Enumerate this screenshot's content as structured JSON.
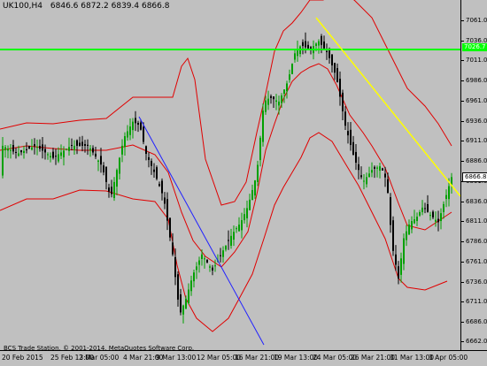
{
  "header": {
    "symbol": "UK100,H4",
    "ohlc": "6846.6 6872.2 6839.4 6866.8"
  },
  "price_axis": {
    "ticks": [
      "7061.0",
      "7036.0",
      "7011.0",
      "6986.0",
      "6961.0",
      "6936.0",
      "6911.0",
      "6886.0",
      "6861.0",
      "6836.0",
      "6811.0",
      "6786.0",
      "6761.0",
      "6736.0",
      "6711.0",
      "6686.0",
      "6662.0"
    ],
    "current_price": "6866.8",
    "hline_price": "7026.7",
    "current_price_bg": "#ffffff",
    "hline_color": "#00ff00"
  },
  "time_axis": {
    "labels": [
      "20 Feb 2015",
      "25 Feb 13:00",
      "2 Mar 05:00",
      "4 Mar 21:00",
      "9 Mar 13:00",
      "12 Mar 05:00",
      "16 Mar 21:00",
      "19 Mar 13:00",
      "24 Mar 05:00",
      "26 Mar 21:00",
      "31 Mar 13:00",
      "3 Apr 05:00"
    ]
  },
  "copyright": "BCS Trade Station, © 2001-2014, MetaQuotes Software Corp.",
  "colors": {
    "background": "#c0c0c0",
    "bull_candle": "#00a000",
    "bear_candle": "#000000",
    "bollinger": "#e00000",
    "trendline_blue": "#2020ff",
    "trendline_yellow": "#ffff00",
    "horizontal_line": "#00ff00"
  }
}
